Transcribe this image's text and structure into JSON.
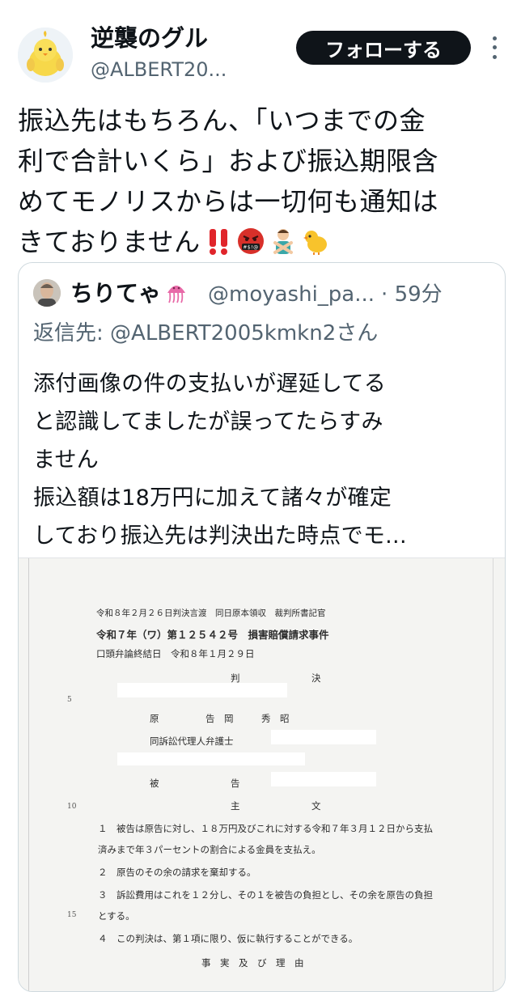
{
  "header": {
    "display_name": "逆襲のグル",
    "handle": "@ALBERT20...",
    "follow_label": "フォローする",
    "avatar_icon": "yellow-chick-avatar-icon",
    "more_icon": "more-vertical-icon"
  },
  "tweet": {
    "lines": [
      "振込先はもちろん、「いつまでの金",
      "利で合計いくら」および振込期限含",
      "めてモノリスからは一切何も通知は",
      "きておりません"
    ],
    "emojis": [
      "double-exclamation-icon",
      "cursing-face-icon",
      "person-gesturing-no-icon",
      "baby-chick-icon"
    ]
  },
  "quote": {
    "name": "ちりてゃ",
    "name_emoji": "jellyfish-icon",
    "handle": "@moyashi_pa...",
    "time": "· 59分",
    "reply_prefix": "返信先: ",
    "reply_mention": "@ALBERT2005kmkn2さん",
    "lines": [
      "添付画像の件の支払いが遅延してる",
      "と認識してましたが誤ってたらすみ",
      "ません",
      "振込額は18万円に加えて諸々が確定",
      "しており振込先は判決出た時点でモ..."
    ]
  },
  "document": {
    "header_line": "令和８年２月２６日判決言渡　同日原本領収　裁判所書記官",
    "case_line": "令和７年（ワ）第１２５４２号　損害賠償請求事件",
    "hearing_line": "口頭弁論終結日　令和８年１月２９日",
    "judgment_1": "判",
    "judgment_2": "決",
    "plaintiff_label": "原　　　　　告　岡　　　秀　昭",
    "attorney_label": "同訴訟代理人弁護士",
    "defendant_1": "被",
    "defendant_2": "告",
    "main_1": "主",
    "main_2": "文",
    "item1a": "１　被告は原告に対し、１８万円及びこれに対する令和７年３月１２日から支払",
    "item1b": "済みまで年３パーセントの割合による金員を支払え。",
    "item2": "２　原告のその余の請求を棄却する。",
    "item3a": "３　訴訟費用はこれを１２分し、その１を被告の負担とし、その余を原告の負担",
    "item3b": "とする。",
    "item4": "４　この判決は、第１項に限り、仮に執行することができる。",
    "footer": "事　実　及　び　理　由",
    "line_numbers": [
      "5",
      "10",
      "15"
    ]
  }
}
